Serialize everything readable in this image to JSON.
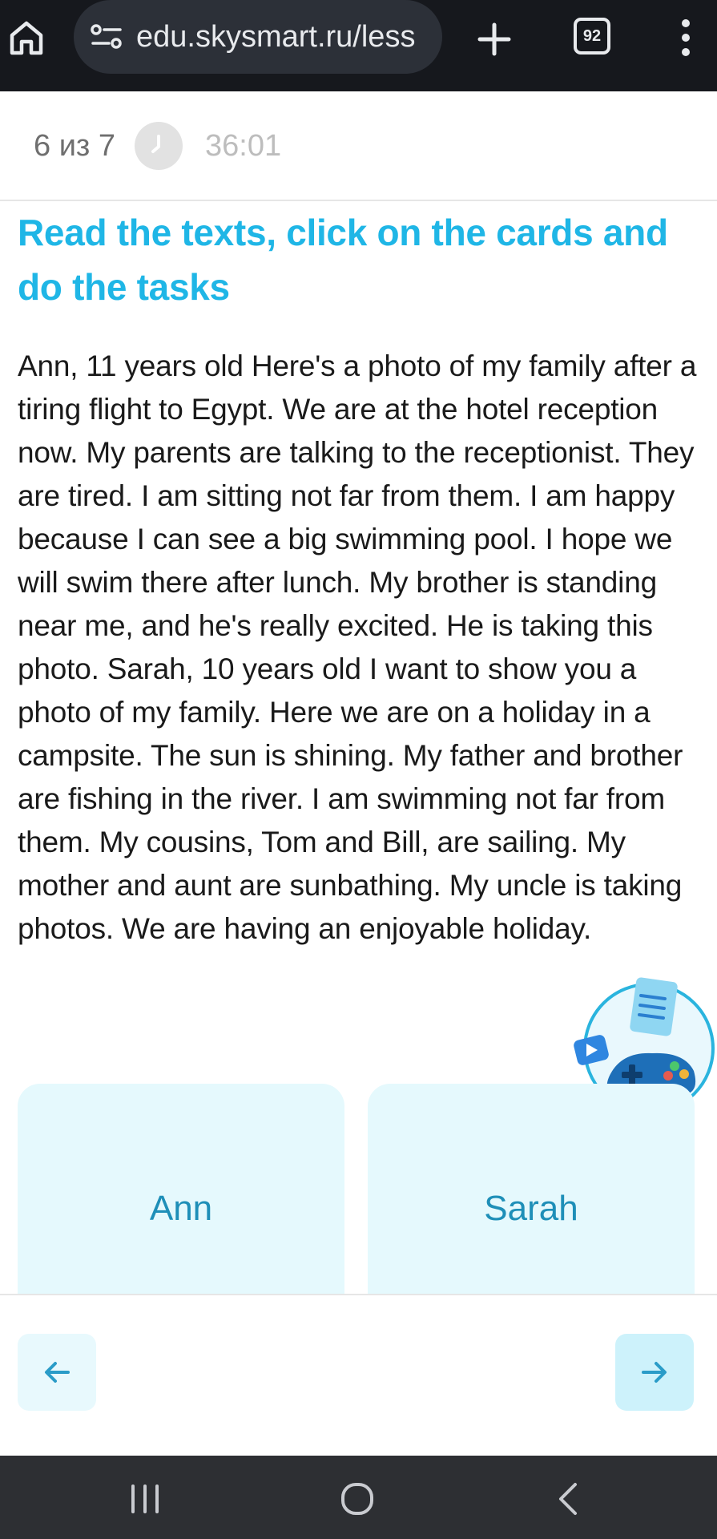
{
  "browser": {
    "url": "edu.skysmart.ru/less",
    "tab_count": "92",
    "icons": [
      "home-icon",
      "site-settings-icon",
      "new-tab-icon",
      "tabs-icon",
      "menu-icon"
    ]
  },
  "lesson": {
    "progress": "6 из 7",
    "timer": "36:01"
  },
  "task": {
    "title": "Read the texts, click on the cards and do the tasks",
    "text": "Ann, 11 years old Here's a photo of my family after a tiring flight to Egypt. We are at the hotel reception now. My parents are talking to the receptionist. They are tired. I am sitting not far from them. I am happy because I can see a big swimming pool. I hope we will swim there after lunch. My brother is standing near me, and he's really excited. He is taking this photo. Sarah, 10 years old I want to show you a photo of my family. Here we are on a holiday in a campsite. The sun is shining. My father and brother are fishing in the river. I am swimming not far from them. My cousins, Tom and Bill, are sailing. My mother and aunt are sunbathing. My uncle is taking photos. We are having an enjoyable holiday."
  },
  "cards": [
    {
      "label": "Ann"
    },
    {
      "label": "Sarah"
    }
  ],
  "colors": {
    "title": "#1fb6e6",
    "card_bg": "#e5f9fd",
    "card_text": "#1e8fb8",
    "browser_bg": "#16181d"
  }
}
